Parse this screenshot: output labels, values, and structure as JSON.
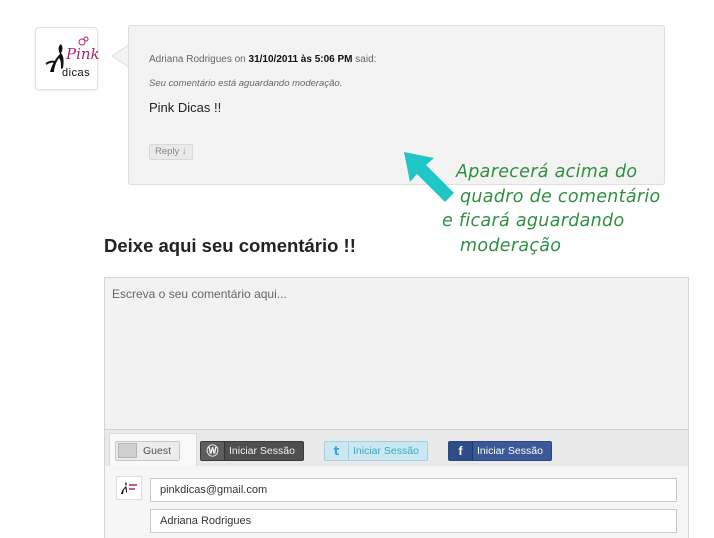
{
  "comment": {
    "author": "Adriana Rodrigues",
    "on_word": "on",
    "date": "31/10/2011 às 5:06 PM",
    "said_word": "said:",
    "moderation_notice": "Seu comentário está aguardando moderação.",
    "text": "Pink Dicas !!",
    "reply_label": "Reply ↓"
  },
  "avatar": {
    "logo_text_pink": "Pink",
    "logo_text_dicas": "dicas",
    "brand_color": "#b0237d"
  },
  "annotation": {
    "lines": [
      "Aparecerá acima do",
      "quadro de comentário",
      "e ficará aguardando",
      "moderação"
    ],
    "arrow_color": "#1fc6c6",
    "text_color": "#2f8f43"
  },
  "section_title": "Deixe aqui seu comentário !!",
  "comment_form": {
    "placeholder": "Escreva o seu comentário aqui...",
    "login": {
      "guest_label": "Guest",
      "wordpress_label": "Iniciar Sessão",
      "twitter_label": "Iniciar Sessão",
      "facebook_label": "Iniciar Sessão"
    },
    "email_value": "pinkdicas@gmail.com",
    "name_value": "Adriana Rodrigues"
  }
}
